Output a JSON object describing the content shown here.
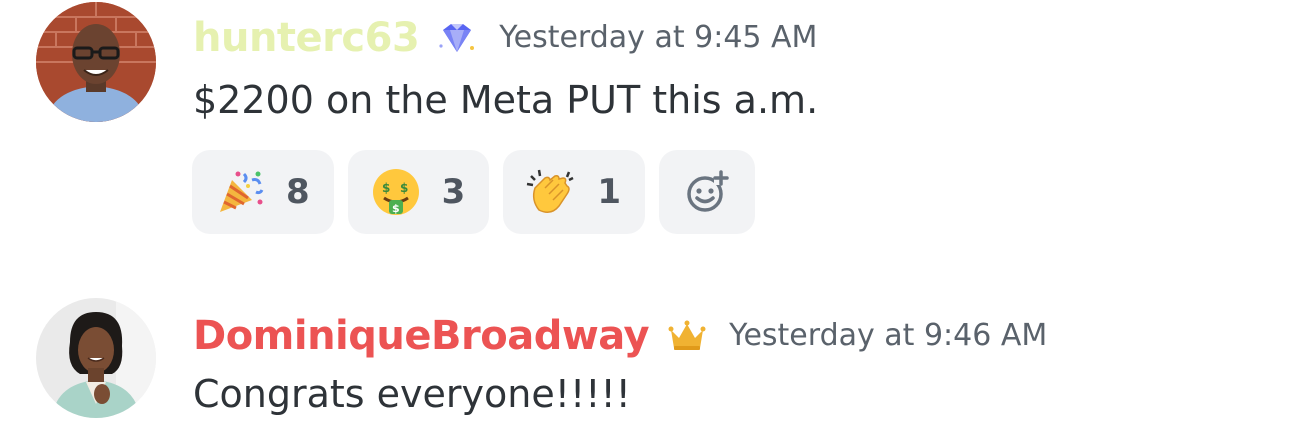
{
  "messages": [
    {
      "username": "hunterc63",
      "badge_icon": "diamond-icon",
      "timestamp": "Yesterday at 9:45 AM",
      "content": "$2200 on the Meta PUT this a.m.",
      "reactions": [
        {
          "emoji": "party-popper-icon",
          "count": "8"
        },
        {
          "emoji": "money-mouth-face-icon",
          "count": "3"
        },
        {
          "emoji": "clapping-hands-icon",
          "count": "1"
        }
      ],
      "add_reaction_icon": "add-reaction-icon",
      "name_color": "#e6f1b0"
    },
    {
      "username": "DominiqueBroadway",
      "badge_icon": "crown-icon",
      "timestamp": "Yesterday at 9:46 AM",
      "content": "Congrats everyone!!!!!",
      "name_color": "#ec5353"
    }
  ]
}
